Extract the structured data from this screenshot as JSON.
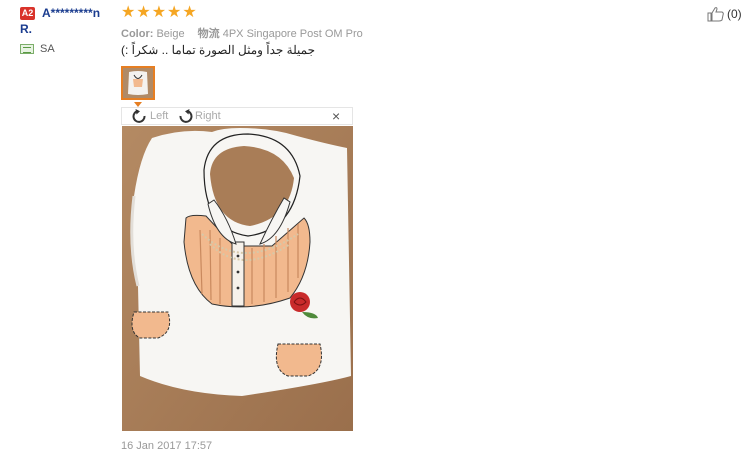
{
  "reviewer": {
    "country_badge": "A2",
    "name_line1": "A*********n",
    "name_line2": "R.",
    "country": "SA"
  },
  "rating": {
    "stars": 5,
    "max": 5
  },
  "meta": {
    "color_key": "Color:",
    "color_value": "Beige",
    "logistics_key": "物流",
    "logistics_value": "4PX Singapore Post OM Pro"
  },
  "review": {
    "text": "جميلة جداً ومثل الصورة تماما .. شكراً :)"
  },
  "viewer": {
    "rotate_left_label": "Left",
    "rotate_right_label": "Right",
    "close_symbol": "×"
  },
  "date": "16 Jan 2017 17:57",
  "helpful": {
    "count": "(0)"
  },
  "colors": {
    "star": "#f5a623",
    "badge": "#d9332b",
    "username": "#1a3c8f",
    "thumb_border": "#e67e22"
  }
}
